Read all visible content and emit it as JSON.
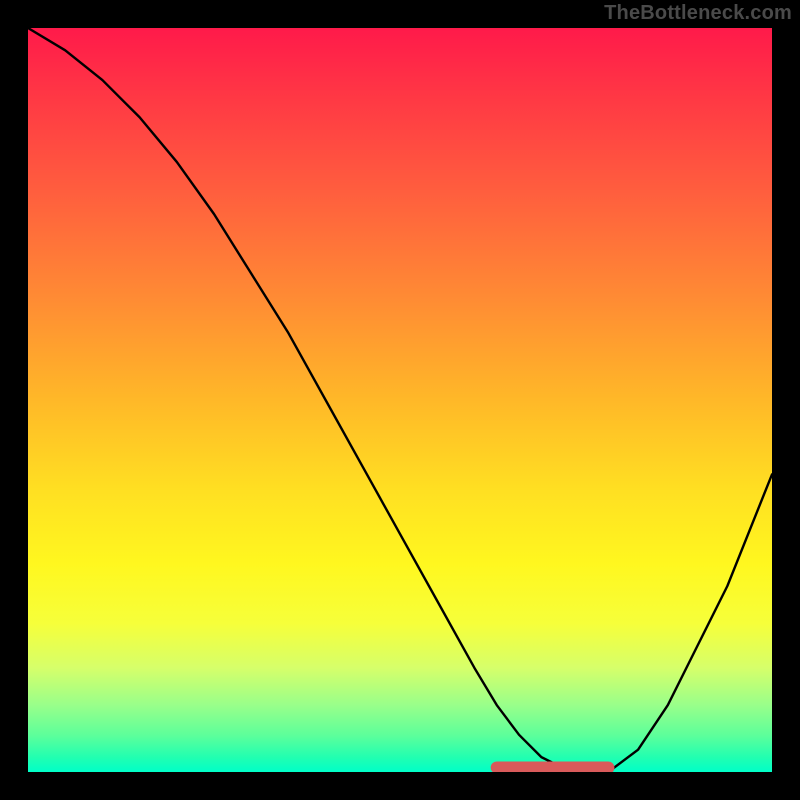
{
  "watermark": "TheBottleneck.com",
  "chart_data": {
    "type": "line",
    "title": "",
    "xlabel": "",
    "ylabel": "",
    "xlim": [
      0,
      100
    ],
    "ylim": [
      0,
      100
    ],
    "x": [
      0,
      5,
      10,
      15,
      20,
      25,
      30,
      35,
      40,
      45,
      50,
      55,
      60,
      63,
      66,
      69,
      72,
      75,
      78,
      82,
      86,
      90,
      94,
      100
    ],
    "values": [
      100,
      97,
      93,
      88,
      82,
      75,
      67,
      59,
      50,
      41,
      32,
      23,
      14,
      9,
      5,
      2,
      0.5,
      0,
      0,
      3,
      9,
      17,
      25,
      40
    ],
    "annotations": {
      "optimal_range_x": [
        63,
        78
      ],
      "marker_dot_x": 78
    },
    "colors": {
      "curve": "#000000",
      "marker": "#d95a5a",
      "gradient_top": "#ff1a4a",
      "gradient_mid": "#ffdf22",
      "gradient_bottom": "#00ffc8",
      "frame": "#000000"
    }
  }
}
